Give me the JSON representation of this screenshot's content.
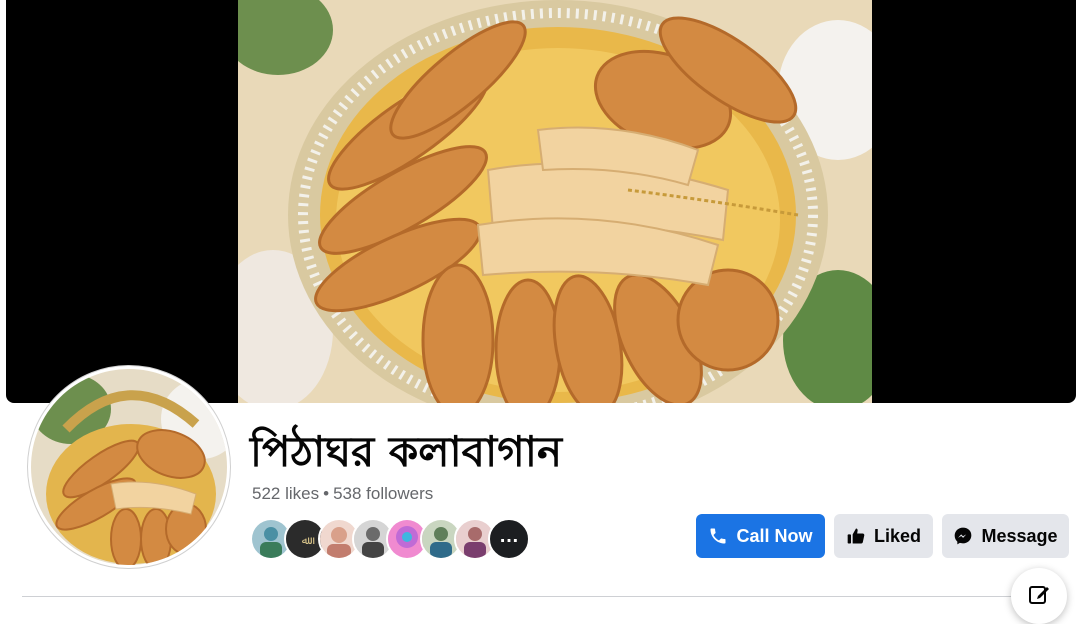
{
  "page": {
    "name": "পিঠাঘর কলাবাগান",
    "likes": "522 likes",
    "separator": "•",
    "followers": "538 followers"
  },
  "cover": {
    "icon": "cover-photo-pitha-platter"
  },
  "profile": {
    "icon": "profile-photo-pitha-basket"
  },
  "friends": {
    "count_shown": 8,
    "colors": [
      "#4a90a4",
      "#2b2b2b",
      "#d9a08a",
      "#6b6b6b",
      "#c06bd6",
      "#5f7f5a",
      "#a86b6b"
    ],
    "more_icon": "ellipsis-icon"
  },
  "actions": {
    "call_label": "Call Now",
    "liked_label": "Liked",
    "message_label": "Message",
    "call_color": "#1b74e4"
  },
  "fab": {
    "icon": "edit-compose-icon"
  }
}
